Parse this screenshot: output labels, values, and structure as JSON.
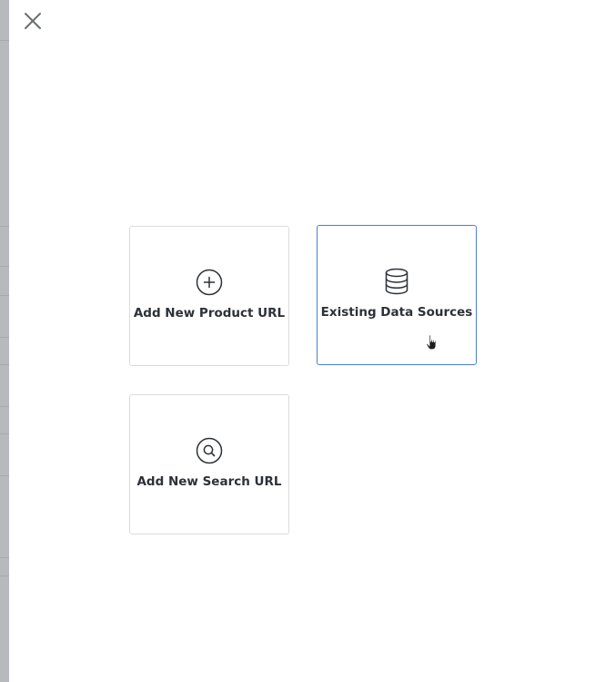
{
  "dialog": {
    "close_icon": "close-icon",
    "options": [
      {
        "id": "add-product-url",
        "icon": "plus-circle-icon",
        "label": "Add New Product URL",
        "selected": false
      },
      {
        "id": "existing-data-sources",
        "icon": "database-icon",
        "label": "Existing Data Sources",
        "selected": true
      },
      {
        "id": "add-search-url",
        "icon": "search-circle-icon",
        "label": "Add New Search URL",
        "selected": false
      }
    ]
  },
  "colors": {
    "selected_border": "#4a7fd6",
    "card_border": "#dcdcdc",
    "text": "#2d3138",
    "icon": "#2d3138"
  }
}
